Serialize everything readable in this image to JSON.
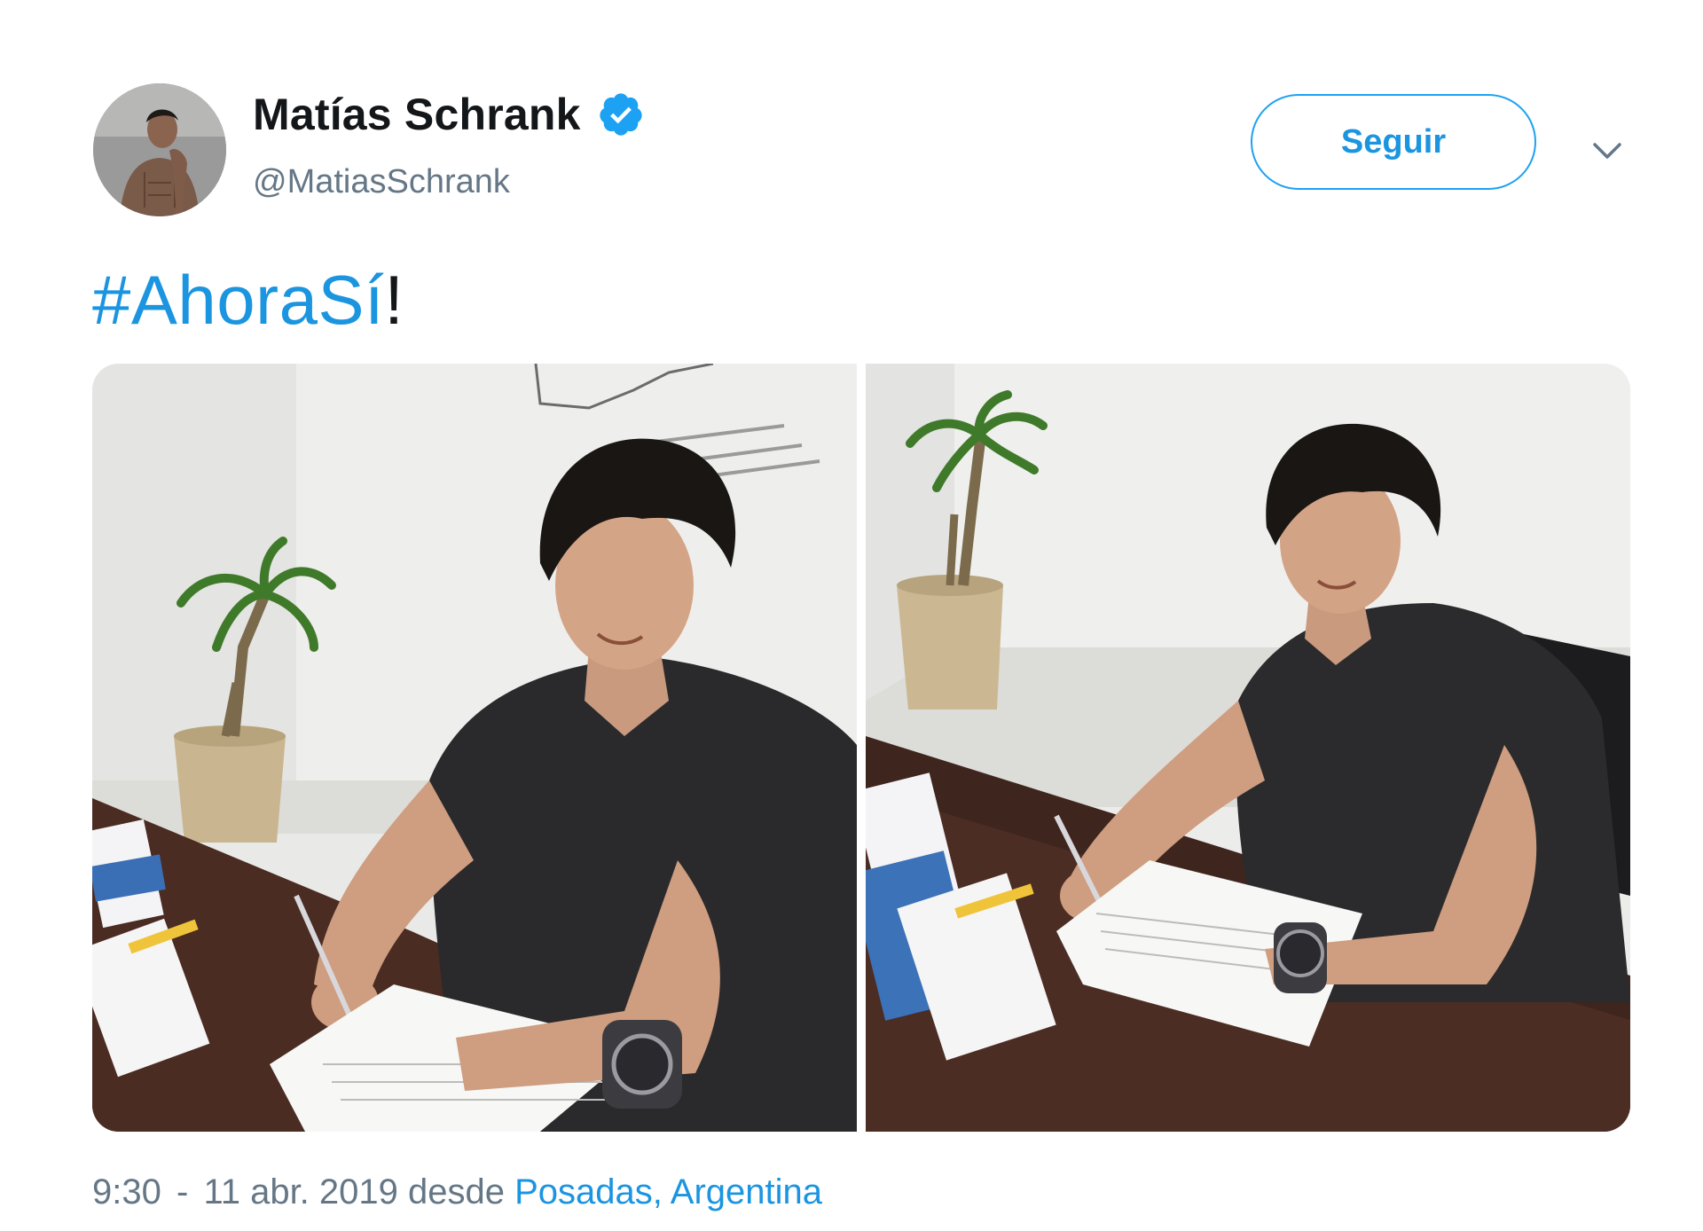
{
  "author": {
    "name": "Matías Schrank",
    "handle": "@MatiasSchrank",
    "verified_icon": "verified-badge-icon",
    "avatar": "profile-photo"
  },
  "actions": {
    "follow_label": "Seguir",
    "menu_icon": "chevron-down-icon"
  },
  "tweet": {
    "hashtag": "#AhoraSí",
    "suffix": "!"
  },
  "media": [
    {
      "description_icon": "photo-signing-document-left"
    },
    {
      "description_icon": "photo-signing-document-right"
    }
  ],
  "meta": {
    "time": "9:30",
    "separator": "-",
    "date": "11 abr. 2019",
    "from_label": "desde",
    "location": "Posadas, Argentina"
  },
  "colors": {
    "link": "#1b95e0",
    "verified": "#1da1f2",
    "secondary_text": "#657786",
    "primary_text": "#14171a"
  }
}
